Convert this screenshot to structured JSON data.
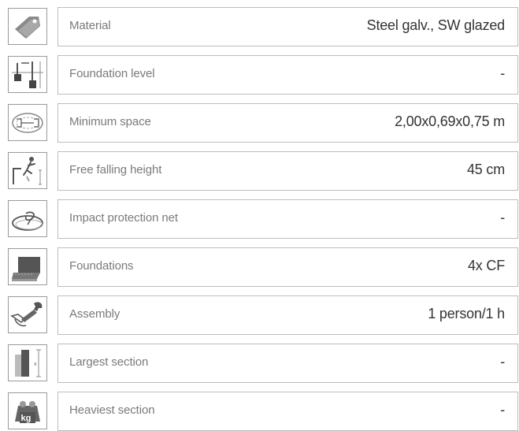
{
  "rows": [
    {
      "icon": "price-tag-icon",
      "label": "Material",
      "value": "Steel galv., SW glazed"
    },
    {
      "icon": "foundation-level-icon",
      "label": "Foundation level",
      "value": "-"
    },
    {
      "icon": "minimum-space-icon",
      "label": "Minimum space",
      "value": "2,00x0,69x0,75 m"
    },
    {
      "icon": "falling-person-icon",
      "label": "Free falling height",
      "value": "45 cm"
    },
    {
      "icon": "impact-net-icon",
      "label": "Impact protection net",
      "value": "-"
    },
    {
      "icon": "foundation-block-icon",
      "label": "Foundations",
      "value": "4x CF"
    },
    {
      "icon": "wrench-hand-icon",
      "label": "Assembly",
      "value": "1 person/1 h"
    },
    {
      "icon": "largest-section-icon",
      "label": "Largest section",
      "value": "-"
    },
    {
      "icon": "weight-kg-icon",
      "label": "Heaviest section",
      "value": "-",
      "icon_text": "kg"
    }
  ]
}
